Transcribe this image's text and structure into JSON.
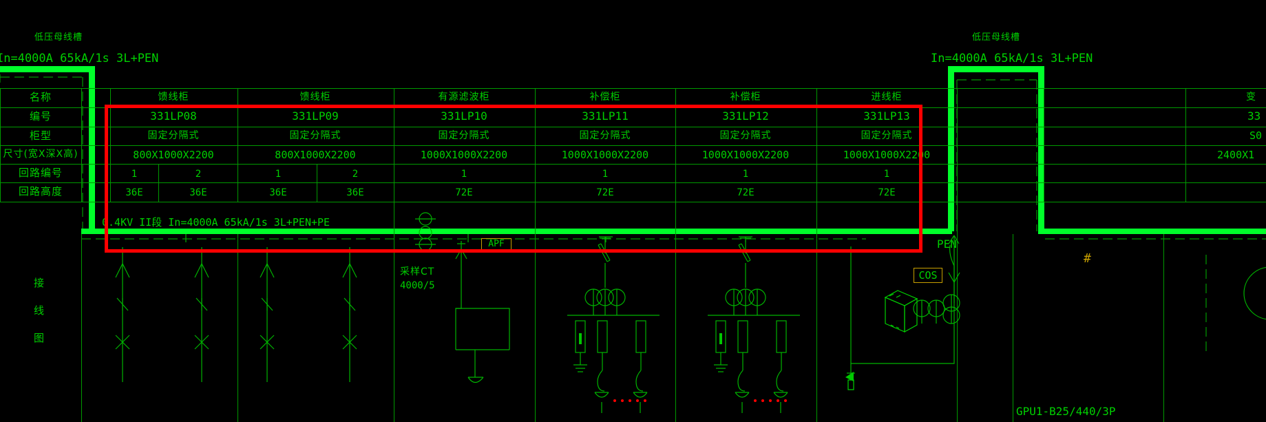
{
  "drawing": {
    "type": "low-voltage-switchgear-single-line-diagram",
    "background_color": "#000000",
    "line_color": "#00c800",
    "highlight_color": "#ff0000",
    "busway_color": "#00ff2a",
    "label_box_color": "#c8a000"
  },
  "busway_labels": {
    "left": {
      "title": "低压母线槽",
      "spec": "In=4000A 65kA/1s 3L+PEN"
    },
    "right": {
      "title": "低压母线槽",
      "spec": "In=4000A 65kA/1s 3L+PEN"
    }
  },
  "bus_label": "0.4KV  II段  In=4000A 65kA/1s 3L+PEN+PE",
  "pen_label": "PEN",
  "side_label": {
    "chars": [
      "接",
      "线",
      "图"
    ]
  },
  "table": {
    "row_headers": [
      "名称",
      "编号",
      "柜型",
      "尺寸(宽X深X高)",
      "回路编号",
      "回路高度"
    ],
    "columns": [
      {
        "name": "馈线柜",
        "number": "331LP08",
        "cabinet_type": "固定分隔式",
        "size": "800X1000X2200",
        "circuit_numbers": [
          "1",
          "2"
        ],
        "circuit_heights": [
          "36E",
          "36E"
        ]
      },
      {
        "name": "馈线柜",
        "number": "331LP09",
        "cabinet_type": "固定分隔式",
        "size": "800X1000X2200",
        "circuit_numbers": [
          "1",
          "2"
        ],
        "circuit_heights": [
          "36E",
          "36E"
        ]
      },
      {
        "name": "有源滤波柜",
        "number": "331LP10",
        "cabinet_type": "固定分隔式",
        "size": "1000X1000X2200",
        "circuit_numbers": [
          "1"
        ],
        "circuit_heights": [
          "72E"
        ]
      },
      {
        "name": "补偿柜",
        "number": "331LP11",
        "cabinet_type": "固定分隔式",
        "size": "1000X1000X2200",
        "circuit_numbers": [
          "1"
        ],
        "circuit_heights": [
          "72E"
        ]
      },
      {
        "name": "补偿柜",
        "number": "331LP12",
        "cabinet_type": "固定分隔式",
        "size": "1000X1000X2200",
        "circuit_numbers": [
          "1"
        ],
        "circuit_heights": [
          "72E"
        ]
      },
      {
        "name": "进线柜",
        "number": "331LP13",
        "cabinet_type": "固定分隔式",
        "size": "1000X1000X2200",
        "circuit_numbers": [
          "1"
        ],
        "circuit_heights": [
          "72E"
        ]
      },
      {
        "name": "变",
        "number": "33",
        "cabinet_type": "S0",
        "size": "2400X1",
        "circuit_numbers": [],
        "circuit_heights": []
      }
    ]
  },
  "schematic_labels": {
    "apf": "APF",
    "cos": "COS",
    "sampling_ct_name": "采样CT",
    "sampling_ct_ratio": "4000/5",
    "surge_device": "GPU1-B25/440/3P",
    "hash_marker": "#"
  }
}
